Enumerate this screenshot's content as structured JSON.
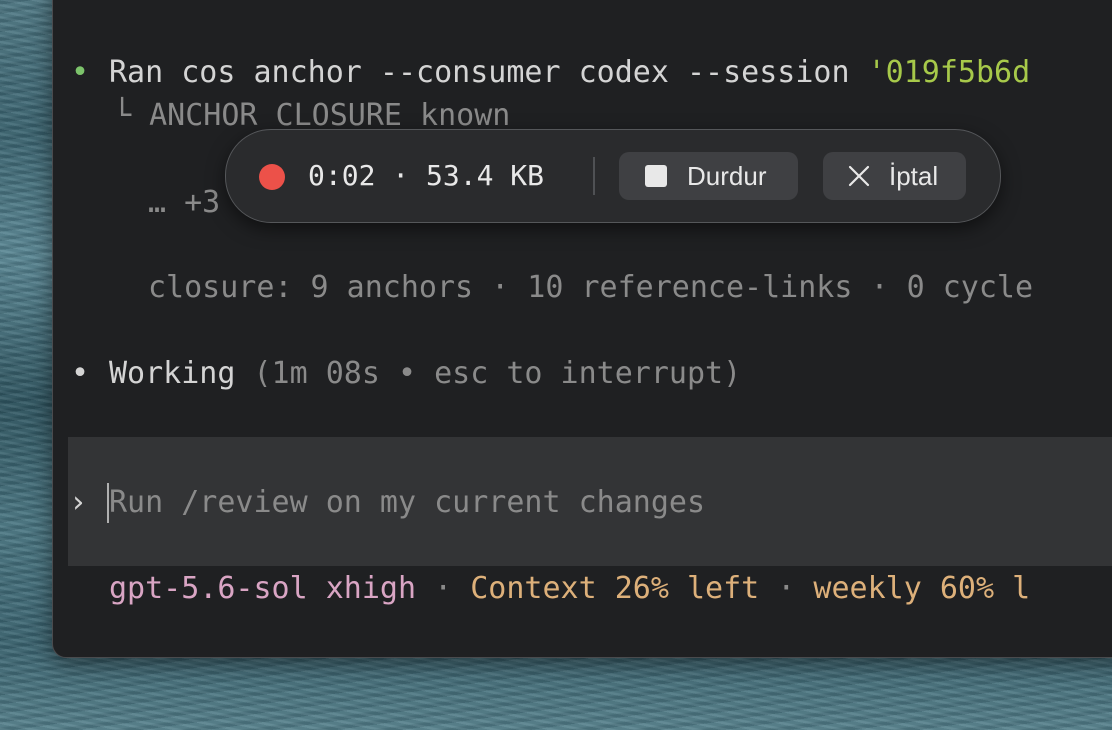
{
  "terminal": {
    "command_line": {
      "prefix": "Ran ",
      "command": "cos anchor --consumer codex --session ",
      "session_arg": "'019f5b6d"
    },
    "output_line1": "└ ANCHOR CLOSURE known",
    "truncation": "… +3",
    "closure_line": "closure: 9 anchors · 10 reference-links · 0 cycle",
    "working": {
      "label": "Working",
      "detail": " (1m 08s • esc to interrupt)"
    }
  },
  "composer": {
    "prompt_symbol": "›",
    "placeholder": "Run /review on my current changes"
  },
  "status_bar": {
    "model": "gpt-5.6-sol xhigh",
    "sep1": " · ",
    "context": "Context 26% left",
    "sep2": " · ",
    "weekly": "weekly 60% l"
  },
  "recorder": {
    "elapsed": "0:02",
    "separator": " · ",
    "size": "53.4 KB",
    "stop_label": "Durdur",
    "cancel_label": "İptal",
    "accent_color": "#ec5149"
  },
  "colors": {
    "terminal_bg": "#1f2022",
    "composer_bg": "#333436",
    "command_green": "#a7c94a",
    "model_pink": "#d9a5c4",
    "status_orange": "#ddb07a"
  }
}
